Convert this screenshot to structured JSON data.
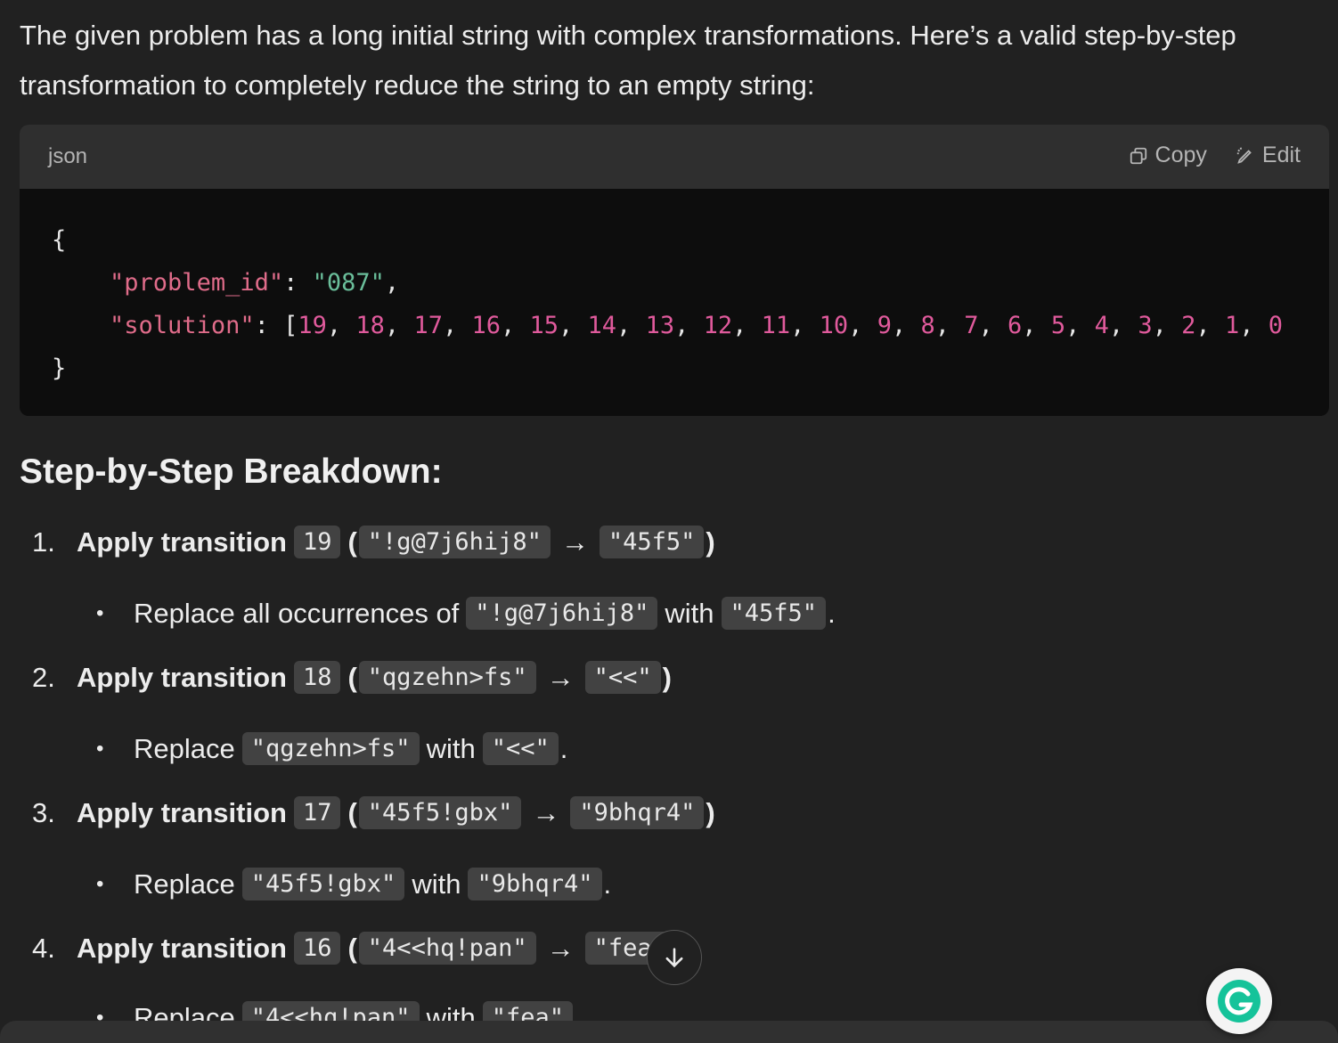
{
  "intro": "The given problem has a long initial string with complex transformations. Here’s a valid step-by-step transformation to completely reduce the string to an empty string:",
  "code": {
    "lang": "json",
    "copy_label": "Copy",
    "edit_label": "Edit",
    "open_brace": "{",
    "close_brace": "}",
    "key1": "\"problem_id\"",
    "val1": "\"087\"",
    "key2": "\"solution\"",
    "solution": [
      "19",
      "18",
      "17",
      "16",
      "15",
      "14",
      "13",
      "12",
      "11",
      "10",
      "9",
      "8",
      "7",
      "6",
      "5",
      "4",
      "3",
      "2",
      "1",
      "0"
    ]
  },
  "heading": "Step-by-Step Breakdown:",
  "steps": [
    {
      "num": "1.",
      "title": "Apply transition",
      "id": "19",
      "from": "\"!g@7j6hij8\"",
      "to": "\"45f5\"",
      "sub_verb": "Replace all occurrences of",
      "sub_with": "with"
    },
    {
      "num": "2.",
      "title": "Apply transition",
      "id": "18",
      "from": "\"qgzehn>fs\"",
      "to": "\"<<\"",
      "sub_verb": "Replace",
      "sub_with": "with"
    },
    {
      "num": "3.",
      "title": "Apply transition",
      "id": "17",
      "from": "\"45f5!gbx\"",
      "to": "\"9bhqr4\"",
      "sub_verb": "Replace",
      "sub_with": "with"
    },
    {
      "num": "4.",
      "title": "Apply transition",
      "id": "16",
      "from": "\"4<<hq!pan\"",
      "to": "\"fea\"",
      "sub_verb": "Replace",
      "sub_with": "with"
    }
  ],
  "icons": {
    "copy": "copy-icon",
    "edit": "pencil-icon",
    "scroll": "arrow-down-icon",
    "grammarly": "grammarly-icon"
  },
  "colors": {
    "background": "#212121",
    "code_bg": "#0d0d0d",
    "header_bg": "#2f2f2f",
    "key": "#e06c8a",
    "string": "#6abe9a",
    "number": "#e05a9c"
  }
}
